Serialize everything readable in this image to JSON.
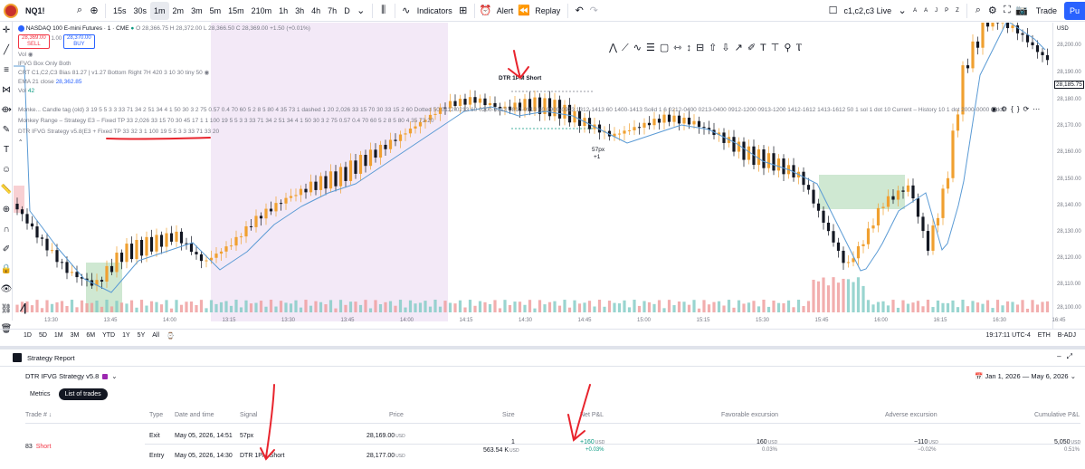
{
  "toolbar": {
    "symbol": "NQ1!",
    "intervals": [
      "15s",
      "30s",
      "1m",
      "2m",
      "3m",
      "5m",
      "15m",
      "210m",
      "1h",
      "3h",
      "4h",
      "7h",
      "D"
    ],
    "active_interval": "1m",
    "indicators_label": "Indicators",
    "alert_label": "Alert",
    "replay_label": "Replay",
    "layout_label": "c1,c2,c3 Live",
    "letters": [
      "A",
      "A",
      "J",
      "P",
      "Z"
    ],
    "trade_label": "Trade",
    "publish_label": "Pu"
  },
  "legend": {
    "title": "NASDAQ 100 E-mini Futures · 1 · CME",
    "ohlc": "O 28,366.75  H 28,372.00  L 28,366.50  C 28,369.00 +1.50 (+0.01%)",
    "sell_price": "28,369.00",
    "sell_label": "SELL",
    "spread": "1.00",
    "buy_price": "28,370.00",
    "buy_label": "BUY",
    "vol": "Vol",
    "ifvg": "IFVG Box Only Both",
    "crt": "CRT C1,C2,C3 Bias 81.27 | v1.27 Bottom Right 7H 420 3 10 30 tiny 50",
    "ema_label": "EMA 21 close",
    "ema_value": "28,362.85",
    "vol2_label": "Vol",
    "vol2_value": "42"
  },
  "long_legend": {
    "row1": "Monke...  Candle tag (old) 3 19 5 5 3 3 33 71 34 2 51 34 4 1 50 30 3 2 75 0.57 0.4 70 60 5 2 8 5 80 4 35 73 1 dashed 1 20 2,026 33 15 70 30 33 15 2 60 Dotted 50 0112-0213 60 0200-0213 0812-0913 60 0900-0913 1312-1413 60 1400-1413 Solid 1 6 0212-0400 0213-0400 0912-1200 0913-1200 1412-1612 1413-1612 50 1 sol 1 dot 10 Current – History 10 1 dot 2000-0000 1 dot 0200-0",
    "row2": "Monkey Range – Strategy E3 – Fixed TP 33 2,026 33 15 70 30 45 17 1 1 100 19 5 5 3 3 33 71 34 2 51 34 4 1 50 30 3 2 75 0.57 0.4 70 60 5 2 8 5 80 4 35 73 20",
    "row3": "DTR IFVG Strategy v5.8(E3 + Fixed TP 33 32 3 1 100 19 5 5 3 3 33 71 33 20"
  },
  "chart_annotations": {
    "trade_label": "DTR 1PM Short",
    "exit_label": "57px",
    "exit_sub": "+1"
  },
  "price_axis": {
    "currency": "USD",
    "current_price": "28,185.75",
    "labels": [
      "28,200.00",
      "28,190.00",
      "28,180.00",
      "28,170.00",
      "28,160.00",
      "28,150.00",
      "28,140.00",
      "28,130.00",
      "28,120.00",
      "28,110.00",
      "28,100.00"
    ]
  },
  "time_axis": {
    "labels": [
      "13:30",
      "13:45",
      "14:00",
      "13:15",
      "13:30",
      "13:45",
      "14:00",
      "14:15",
      "14:30",
      "14:45",
      "15:00",
      "15:15",
      "15:30",
      "15:45",
      "16:00",
      "16:15",
      "16:30",
      "16:45"
    ]
  },
  "range_bar": {
    "ranges": [
      "1D",
      "5D",
      "1M",
      "3M",
      "6M",
      "YTD",
      "1Y",
      "5Y",
      "All"
    ],
    "clock": "19:17:11 UTC-4",
    "session": "ETH",
    "adj": "B-ADJ"
  },
  "report": {
    "header_label": "Strategy Report",
    "strategy_name": "DTR IFVG Strategy v5.8",
    "date_range": "Jan 1, 2026 — May 6, 2026",
    "tabs": [
      "Metrics",
      "List of trades"
    ],
    "active_tab": "List of trades",
    "columns": {
      "trade": "Trade # ↓",
      "type": "Type",
      "datetime": "Date and time",
      "signal": "Signal",
      "price": "Price",
      "size": "Size",
      "pnl": "Net P&L",
      "favorable": "Favorable excursion",
      "adverse": "Adverse excursion",
      "cumulative": "Cumulative P&L"
    },
    "trade": {
      "number": "83",
      "direction": "Short",
      "exit_type": "Exit",
      "exit_datetime": "May 05, 2026, 14:51",
      "exit_signal": "57px",
      "exit_price": "28,169.00",
      "entry_type": "Entry",
      "entry_datetime": "May 05, 2026, 14:30",
      "entry_signal": "DTR 1PM Short",
      "entry_price": "28,177.00",
      "currency": "USD",
      "size_contracts": "1",
      "size_value": "563.54 K",
      "pnl_value": "+160",
      "pnl_pct": "+0.03%",
      "fav_value": "160",
      "fav_pct": "0.03%",
      "adv_value": "−110",
      "adv_pct": "−0.02%",
      "cum_value": "5,050",
      "cum_pct": "0.51%"
    }
  },
  "colors": {
    "up_candle": "#f0a030",
    "down_candle": "#131722",
    "ema": "#5b9bd5",
    "session_shade": "#f3e9f7",
    "fvg_box": "#cfe8d2",
    "fvg_red": "#f8d0d3",
    "vol_up": "#80cbc4",
    "vol_down": "#ef9a9a",
    "annotation_red": "#e8242d"
  }
}
